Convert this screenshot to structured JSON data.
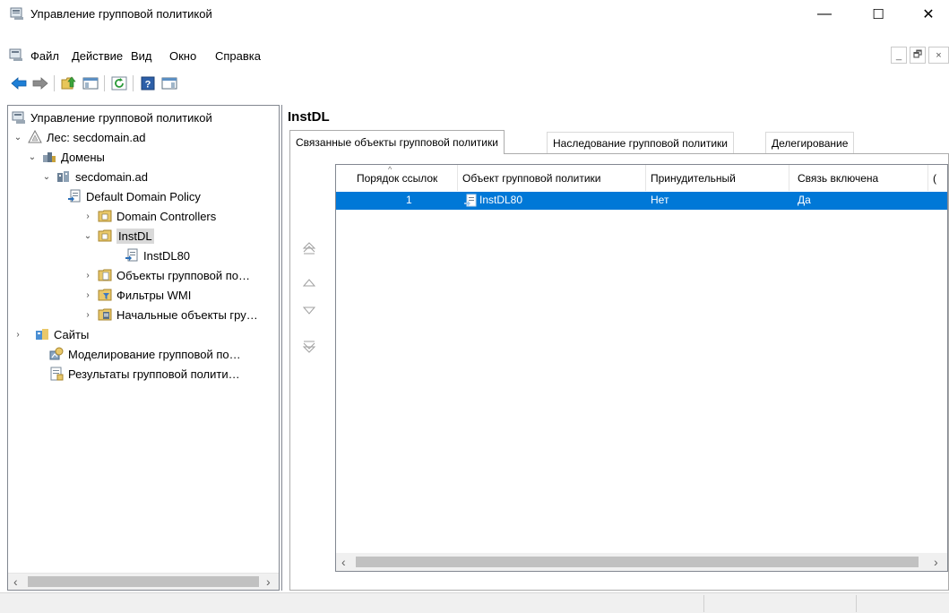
{
  "window": {
    "title": "Управление групповой политикой",
    "minimize_glyph": "—",
    "maximize_glyph": "☐",
    "close_glyph": "✕"
  },
  "menu": {
    "items": [
      "Файл",
      "Действие",
      "Вид",
      "Окно",
      "Справка"
    ],
    "mdi_minimize": "_",
    "mdi_restore": "🗗",
    "mdi_close": "×"
  },
  "toolbar": {
    "buttons": [
      "back-icon",
      "forward-icon",
      "up-folder-icon",
      "show-hide-tree-icon",
      "refresh-icon",
      "help-icon",
      "properties-icon"
    ]
  },
  "tree": {
    "items": [
      {
        "label": "Управление групповой политикой",
        "icon": "gpm-console-icon"
      },
      {
        "label": "Лес: secdomain.ad",
        "icon": "forest-icon"
      },
      {
        "label": "Домены",
        "icon": "domains-icon"
      },
      {
        "label": "secdomain.ad",
        "icon": "domain-icon"
      },
      {
        "label": "Default Domain Policy",
        "icon": "gpo-link-icon"
      },
      {
        "label": "Domain Controllers",
        "icon": "ou-icon"
      },
      {
        "label": "InstDL",
        "icon": "ou-icon"
      },
      {
        "label": "InstDL80",
        "icon": "gpo-link-icon"
      },
      {
        "label": "Объекты групповой по…",
        "icon": "gpo-container-icon"
      },
      {
        "label": "Фильтры WMI",
        "icon": "wmi-filter-icon"
      },
      {
        "label": "Начальные объекты гру…",
        "icon": "starter-gpo-icon"
      },
      {
        "label": "Сайты",
        "icon": "sites-icon"
      },
      {
        "label": "Моделирование групповой по…",
        "icon": "modeling-icon"
      },
      {
        "label": "Результаты групповой полити…",
        "icon": "results-icon"
      }
    ],
    "scroll_left": "‹",
    "scroll_right": "›"
  },
  "details": {
    "title": "InstDL",
    "tabs": [
      "Связанные объекты групповой политики",
      "Наследование групповой политики",
      "Делегирование"
    ],
    "columns": [
      "Порядок ссылок",
      "Объект групповой политики",
      "Принудительный",
      "Связь включена",
      "("
    ],
    "rows": [
      {
        "order": "1",
        "gpo": "InstDL80",
        "enforced": "Нет",
        "enabled": "Да"
      }
    ],
    "sort_indicator": "^",
    "scroll_left": "‹",
    "scroll_right": "›"
  },
  "colors": {
    "selection": "#0078d7",
    "toolbar_arrow": "#1e7fd6"
  }
}
